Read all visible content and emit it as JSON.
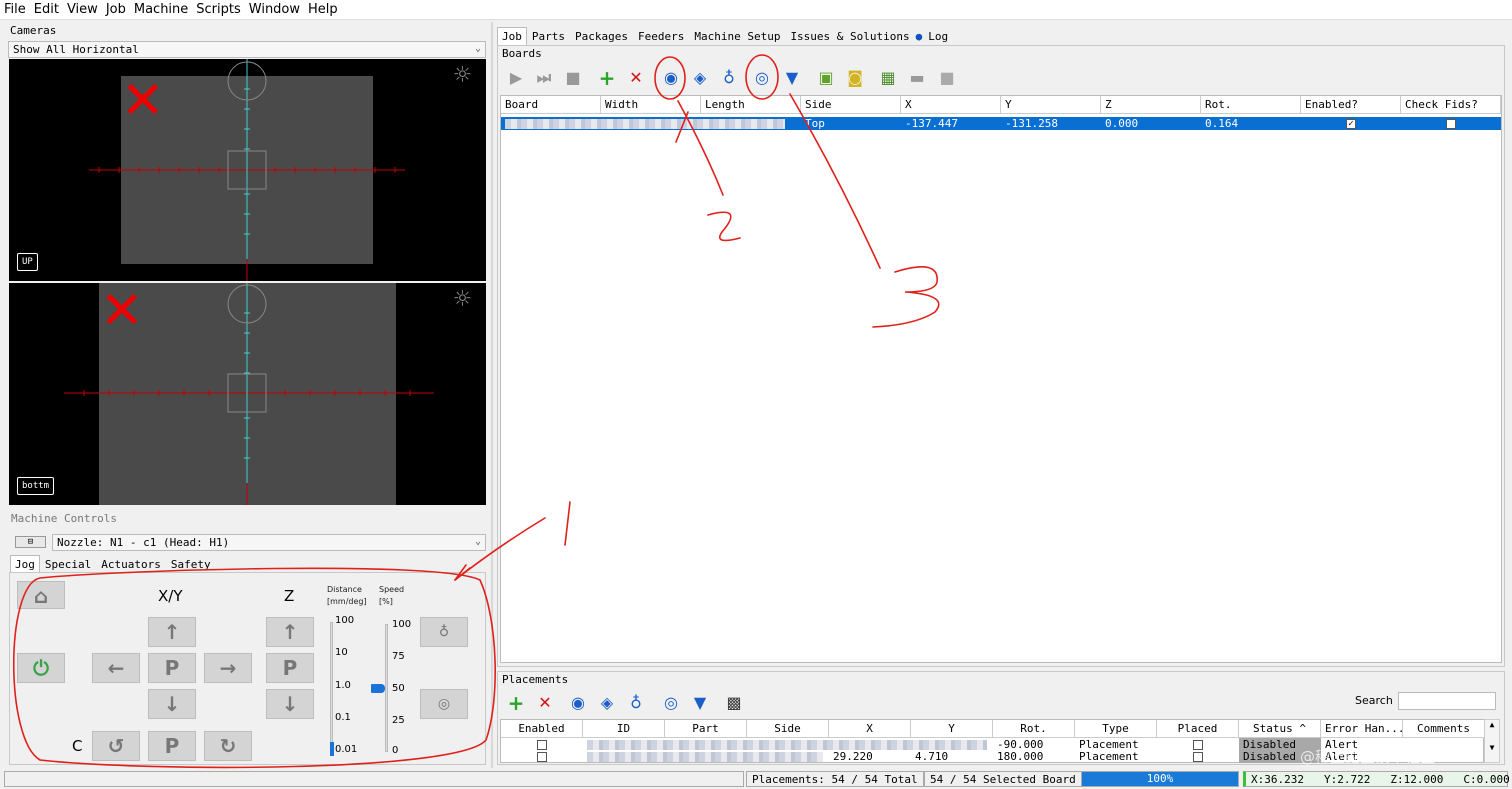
{
  "menu": [
    "File",
    "Edit",
    "View",
    "Job",
    "Machine",
    "Scripts",
    "Window",
    "Help"
  ],
  "cameras": {
    "label": "Cameras",
    "layout_select": "Show All Horizontal",
    "top_view_label": "UP",
    "bottom_view_label": "bottm"
  },
  "machine_controls": {
    "label": "Machine Controls",
    "nozzle_select": "Nozzle: N1 - c1 (Head: H1)",
    "tabs": [
      "Jog",
      "Special",
      "Actuators",
      "Safety"
    ],
    "xy_label": "X/Y",
    "z_label": "Z",
    "c_label": "C",
    "park_label": "P",
    "distance_label": "Distance",
    "distance_unit": "[mm/deg]",
    "speed_label": "Speed",
    "speed_unit": "[%]",
    "distance_ticks": [
      "100",
      "10",
      "1.0",
      "0.1",
      "0.01"
    ],
    "speed_ticks": [
      "100",
      "75",
      "50",
      "25",
      "0"
    ],
    "speed_value": 50
  },
  "main_tabs": [
    "Job",
    "Parts",
    "Packages",
    "Feeders",
    "Machine Setup",
    "Issues & Solutions",
    "Log"
  ],
  "boards": {
    "label": "Boards",
    "columns": [
      "Board",
      "Width",
      "Length",
      "Side",
      "X",
      "Y",
      "Z",
      "Rot.",
      "Enabled?",
      "Check Fids?"
    ],
    "rows": [
      {
        "side": "Top",
        "x": "-137.447",
        "y": "-131.258",
        "z": "0.000",
        "rot": "0.164",
        "enabled": true,
        "check_fids": false
      }
    ]
  },
  "placements": {
    "label": "Placements",
    "search_label": "Search",
    "columns": [
      "Enabled",
      "ID",
      "Part",
      "Side",
      "X",
      "Y",
      "Rot.",
      "Type",
      "Placed",
      "Status ^",
      "Error Han...",
      "Comments"
    ],
    "rows": [
      {
        "x": "",
        "y": "",
        "rot": "-90.000",
        "type": "Placement",
        "status": "Disabled",
        "error": "Alert"
      },
      {
        "x": "29.220",
        "y": "4.710",
        "rot": "180.000",
        "type": "Placement",
        "status": "Disabled",
        "error": "Alert"
      }
    ]
  },
  "status": {
    "placements_total": "Placements: 54 / 54 Total",
    "selected_board": "54 / 54 Selected Board",
    "progress": "100%",
    "progress_value": 1.0,
    "x": "X:36.232",
    "y": "Y:2.722",
    "z": "Z:12.000",
    "c": "C:0.000"
  },
  "annotations": {
    "label1": "1",
    "label2": "2",
    "label3": "3"
  },
  "watermark": "@稀土掘金技术社区",
  "colors": {
    "selection": "#0a6fd2",
    "accent_red": "#e00000",
    "annotation": "#e0201a",
    "crosshair_red": "#c00000",
    "crosshair_cyan": "#3fcfcf"
  }
}
